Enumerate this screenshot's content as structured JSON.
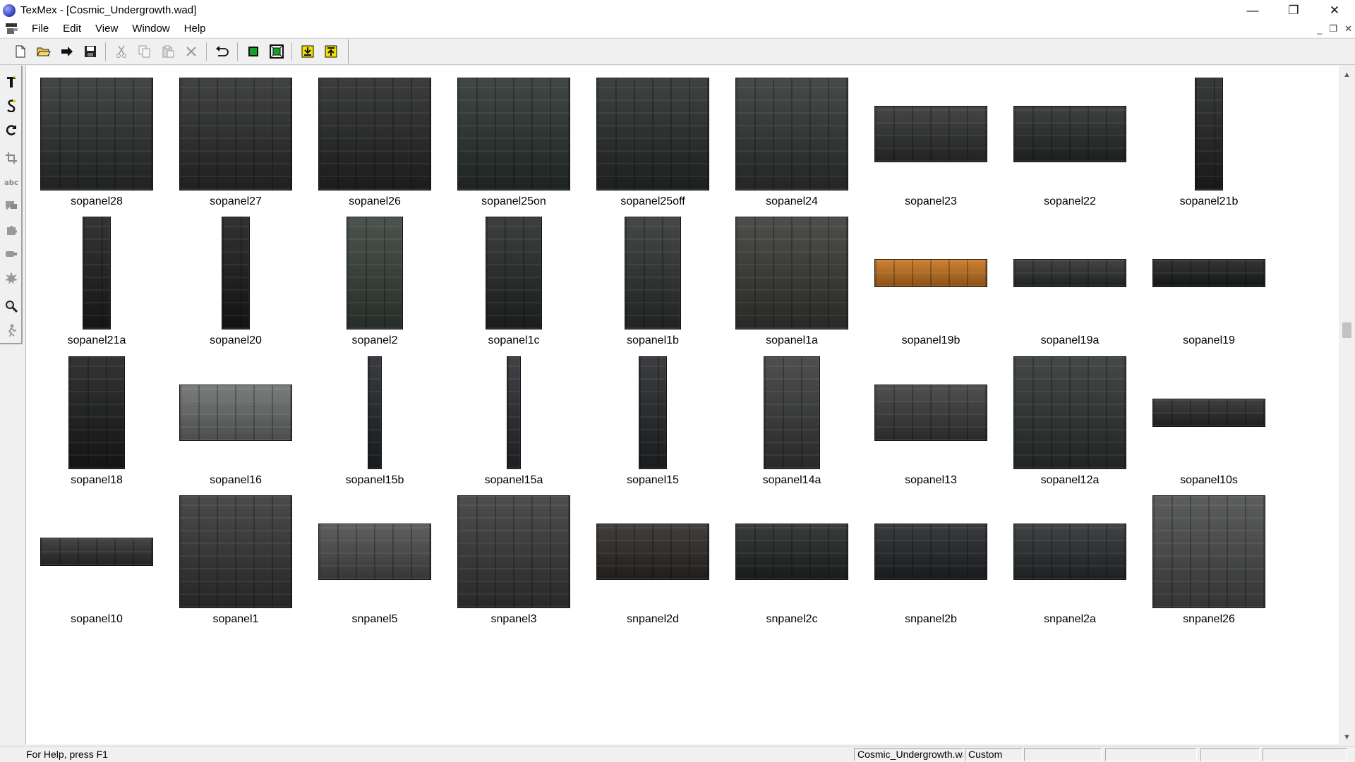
{
  "window": {
    "title": "TexMex - [Cosmic_Undergrowth.wad]",
    "minimize": "—",
    "restore": "❐",
    "close": "✕"
  },
  "menubar": {
    "items": [
      "File",
      "Edit",
      "View",
      "Window",
      "Help"
    ],
    "mdi_minimize": "_",
    "mdi_restore": "❐",
    "mdi_close": "✕"
  },
  "toolbar": {
    "icons": [
      "new-file-icon",
      "open-folder-icon",
      "forward-arrow-icon",
      "save-icon",
      "cut-icon",
      "copy-icon",
      "paste-icon",
      "delete-icon",
      "undo-icon",
      "green-square-icon",
      "green-frame-icon",
      "import-icon",
      "export-icon"
    ]
  },
  "tools": {
    "icons": [
      "text-t-icon",
      "s-tool-icon",
      "rotate-icon",
      "crop-icon",
      "abc-icon",
      "speech-icon",
      "puzzle-icon",
      "brush-icon",
      "burst-icon",
      "zoom-icon",
      "person-icon"
    ]
  },
  "textures": [
    {
      "name": "sopanel28",
      "aspect": "square",
      "color": "#2f3230"
    },
    {
      "name": "sopanel27",
      "aspect": "square",
      "color": "#2c2e2d"
    },
    {
      "name": "sopanel26",
      "aspect": "square",
      "color": "#262827"
    },
    {
      "name": "sopanel25on",
      "aspect": "square",
      "color": "#2b3330"
    },
    {
      "name": "sopanel25off",
      "aspect": "square",
      "color": "#2a2d2d"
    },
    {
      "name": "sopanel24",
      "aspect": "square",
      "color": "#333635"
    },
    {
      "name": "sopanel23",
      "aspect": "wide",
      "color": "#303231"
    },
    {
      "name": "sopanel22",
      "aspect": "wide",
      "color": "#2a2c2c"
    },
    {
      "name": "sopanel21b",
      "aspect": "narrow",
      "color": "#222423"
    },
    {
      "name": "sopanel21a",
      "aspect": "narrow",
      "color": "#1d1f1e"
    },
    {
      "name": "sopanel20",
      "aspect": "narrow",
      "color": "#1a1b1b"
    },
    {
      "name": "sopanel2",
      "aspect": "tall",
      "color": "#384039"
    },
    {
      "name": "sopanel1c",
      "aspect": "tall",
      "color": "#262a28"
    },
    {
      "name": "sopanel1b",
      "aspect": "tall",
      "color": "#2f3331"
    },
    {
      "name": "sopanel1a",
      "aspect": "square",
      "color": "#3a3b38"
    },
    {
      "name": "sopanel19b",
      "aspect": "strip",
      "color": "#c8741e"
    },
    {
      "name": "sopanel19a",
      "aspect": "strip",
      "color": "#2e3130"
    },
    {
      "name": "sopanel19",
      "aspect": "strip",
      "color": "#1e2020"
    },
    {
      "name": "sopanel18",
      "aspect": "tall",
      "color": "#1c1d1d"
    },
    {
      "name": "sopanel16",
      "aspect": "wide",
      "color": "#6c6f6d"
    },
    {
      "name": "sopanel15b",
      "aspect": "thin",
      "color": "#23252b"
    },
    {
      "name": "sopanel15a",
      "aspect": "thin",
      "color": "#2a2c31"
    },
    {
      "name": "sopanel15",
      "aspect": "narrow",
      "color": "#25272a"
    },
    {
      "name": "sopanel14a",
      "aspect": "tall",
      "color": "#3a3b3b"
    },
    {
      "name": "sopanel13",
      "aspect": "wide",
      "color": "#3b3d3b"
    },
    {
      "name": "sopanel12a",
      "aspect": "square",
      "color": "#2f3432"
    },
    {
      "name": "sopanel10s",
      "aspect": "slim",
      "color": "#2a2c2b"
    },
    {
      "name": "sopanel10",
      "aspect": "slim",
      "color": "#303231"
    },
    {
      "name": "sopanel1",
      "aspect": "square",
      "color": "#353735"
    },
    {
      "name": "snpanel5",
      "aspect": "wide",
      "color": "#4d4f4d"
    },
    {
      "name": "snpanel3",
      "aspect": "square",
      "color": "#3a3a3a"
    },
    {
      "name": "snpanel2d",
      "aspect": "wide",
      "color": "#2e2a26"
    },
    {
      "name": "snpanel2c",
      "aspect": "wide",
      "color": "#252727"
    },
    {
      "name": "snpanel2b",
      "aspect": "wide",
      "color": "#24262a"
    },
    {
      "name": "snpanel2a",
      "aspect": "wide",
      "color": "#2b2f30"
    },
    {
      "name": "snpanel26",
      "aspect": "square",
      "color": "#4a4c4b"
    }
  ],
  "statusbar": {
    "help": "For Help, press F1",
    "file": "Cosmic_Undergrowth.wad",
    "palette": "Custom"
  }
}
